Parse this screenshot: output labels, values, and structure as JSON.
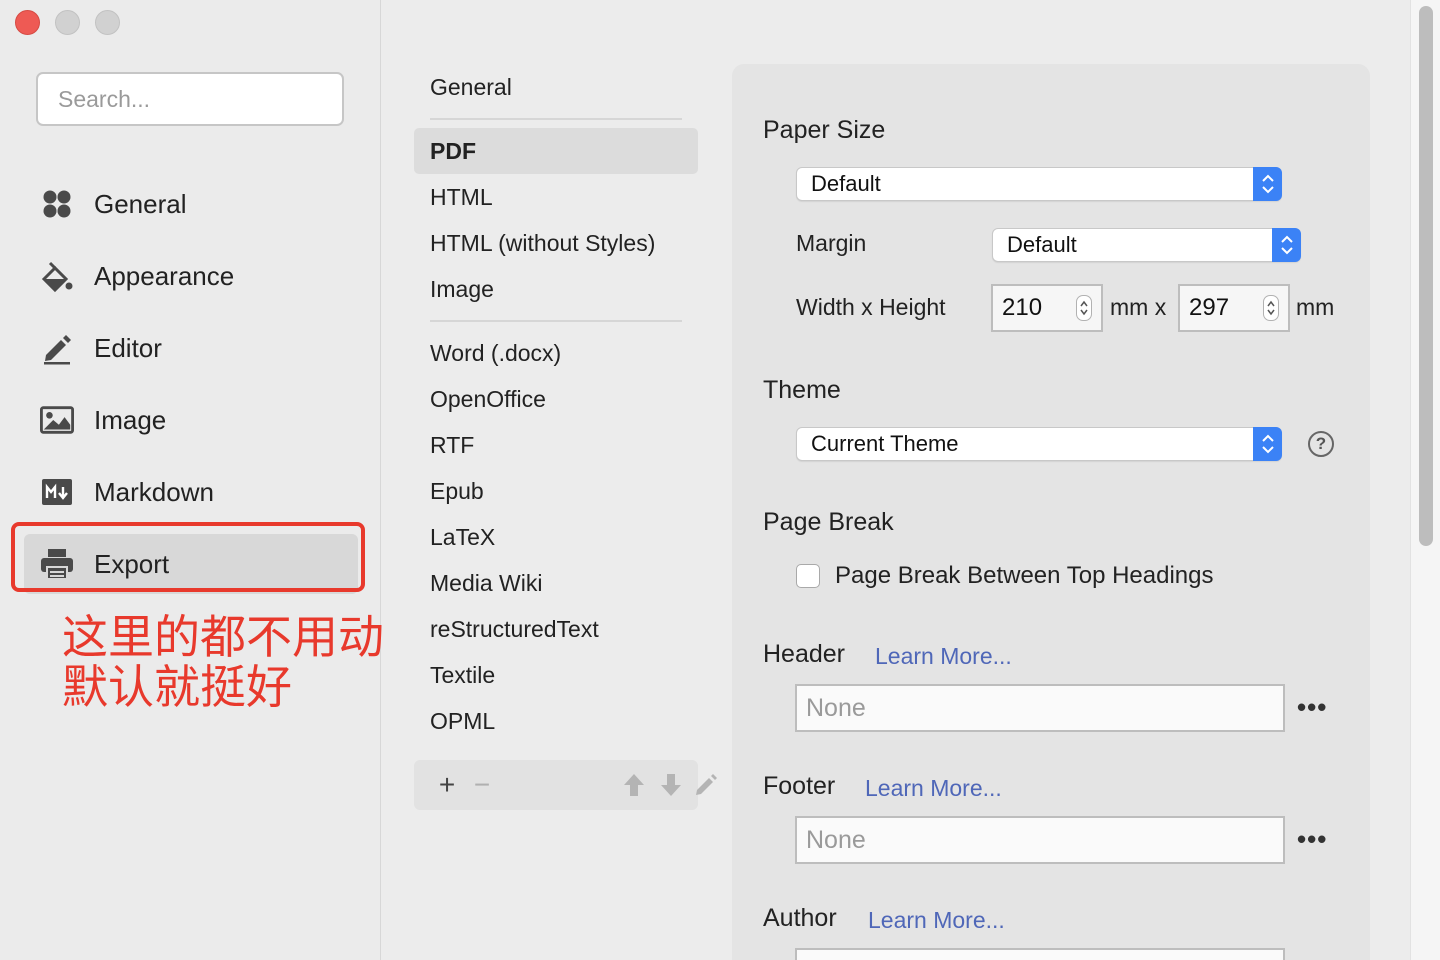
{
  "window": {
    "controls": [
      "close",
      "minimize",
      "maximize"
    ]
  },
  "sidebar": {
    "search_placeholder": "Search...",
    "items": [
      {
        "label": "General",
        "icon": "grid-icon"
      },
      {
        "label": "Appearance",
        "icon": "paint-bucket-icon"
      },
      {
        "label": "Editor",
        "icon": "pencil-icon"
      },
      {
        "label": "Image",
        "icon": "image-icon"
      },
      {
        "label": "Markdown",
        "icon": "markdown-icon"
      },
      {
        "label": "Export",
        "icon": "printer-icon",
        "selected": true
      }
    ],
    "annotation": "这里的都不用动\n默认就挺好",
    "annotation_color": "#e8392c"
  },
  "formats": {
    "items": [
      "General",
      "PDF",
      "HTML",
      "HTML (without Styles)",
      "Image",
      "Word (.docx)",
      "OpenOffice",
      "RTF",
      "Epub",
      "LaTeX",
      "Media Wiki",
      "reStructuredText",
      "Textile",
      "OPML"
    ],
    "selected": "PDF",
    "toolbar": {
      "add": "+",
      "remove": "−"
    }
  },
  "settings": {
    "paper_size": {
      "title": "Paper Size",
      "value": "Default"
    },
    "margin": {
      "label": "Margin",
      "value": "Default"
    },
    "dimensions": {
      "label": "Width x Height",
      "width": "210",
      "height": "297",
      "unit_mid": "mm x",
      "unit_end": "mm"
    },
    "theme": {
      "title": "Theme",
      "value": "Current Theme",
      "help": "?"
    },
    "page_break": {
      "title": "Page Break",
      "checkbox_label": "Page Break Between Top Headings",
      "checked": false
    },
    "header": {
      "title": "Header",
      "link": "Learn More...",
      "value": "None",
      "more": "•••"
    },
    "footer": {
      "title": "Footer",
      "link": "Learn More...",
      "value": "None",
      "more": "•••"
    },
    "author": {
      "title": "Author",
      "link": "Learn More..."
    }
  },
  "colors": {
    "accent": "#3b82f6",
    "link": "#4f67b8"
  }
}
